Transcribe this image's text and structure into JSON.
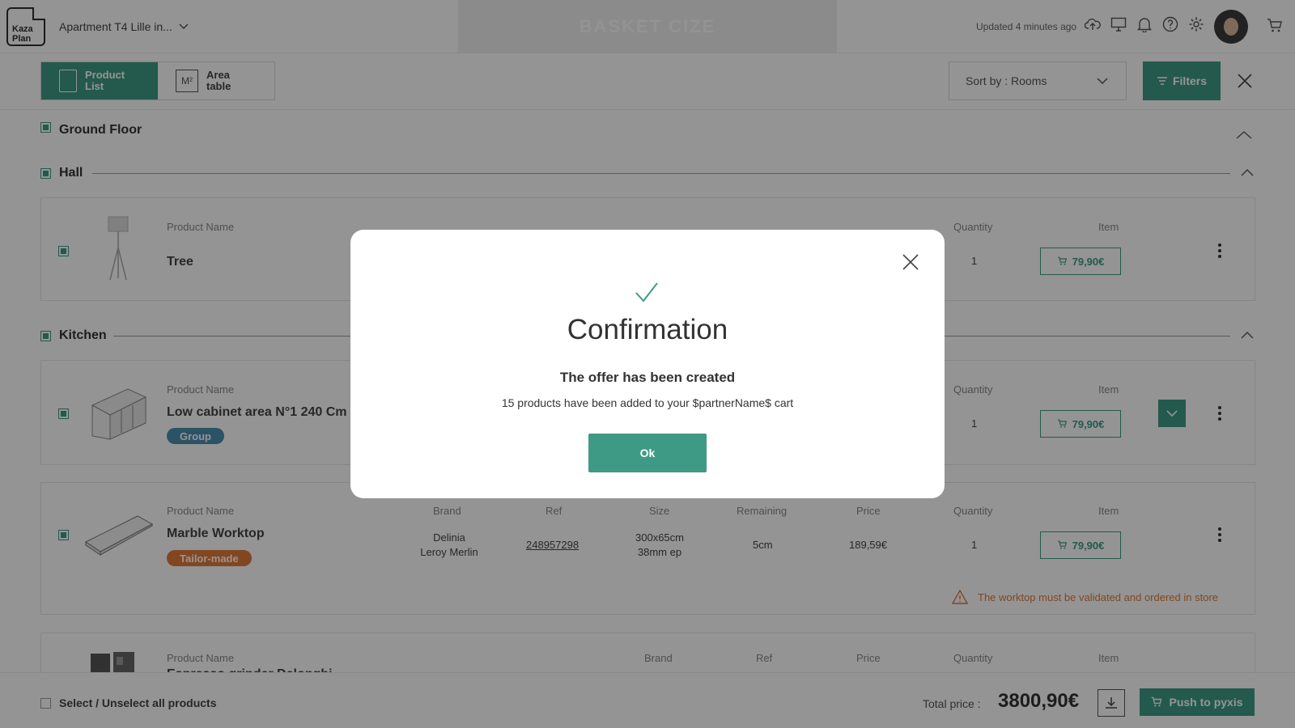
{
  "header": {
    "logo_line1": "Kaza",
    "logo_line2": "Plan",
    "project_name": "Apartment T4 Lille in...",
    "center_tab": "BASKET CIZE",
    "updated": "Updated 4 minutes ago",
    "icons": [
      "cloud-upload-icon",
      "monitor-icon",
      "bell-icon",
      "help-icon",
      "gear-icon",
      "cart-icon"
    ]
  },
  "toolbar": {
    "views": [
      {
        "label_line1": "Product",
        "label_line2": "List",
        "icon": "list-doc-icon",
        "active": true
      },
      {
        "label_line1": "Area",
        "label_line2": "table",
        "icon": "m2-icon",
        "icon_text": "M²",
        "active": false
      }
    ],
    "sort_label": "Sort by : Rooms",
    "filters_label": "Filters"
  },
  "floor": {
    "name": "Ground Floor"
  },
  "rooms": [
    {
      "name": "Hall"
    },
    {
      "name": "Kitchen"
    }
  ],
  "columns": {
    "product_name": "Product Name",
    "brand": "Brand",
    "ref": "Ref",
    "size": "Size",
    "remaining": "Remaining",
    "price": "Price",
    "quantity": "Quantity",
    "item": "Item"
  },
  "products": [
    {
      "name": "Tree",
      "quantity": "1",
      "item_price": "79,90€"
    },
    {
      "name": "Low cabinet area N°1 240 Cm",
      "tag": "Group",
      "quantity": "1",
      "item_price": "79,90€"
    },
    {
      "name": "Marble Worktop",
      "tag": "Tailor-made",
      "brand_line1": "Delinia",
      "brand_line2": "Leroy Merlin",
      "ref": "248957298",
      "size_line1": "300x65cm",
      "size_line2": "38mm ep",
      "remaining": "5cm",
      "price": "189,59€",
      "quantity": "1",
      "item_price": "79,90€",
      "warning": "The worktop must be validated and ordered in store"
    },
    {
      "name": "Espresso grinder Delonghi"
    }
  ],
  "colors": {
    "accent": "#3f9a85",
    "tag_group": "#4a8fb0",
    "tag_tailor": "#e07a3a",
    "warning": "#e07a3a"
  },
  "footer": {
    "select_all": "Select / Unselect all products",
    "total_label": "Total price :",
    "total_value": "3800,90€",
    "push_label": "Push to pyxis"
  },
  "modal": {
    "title": "Confirmation",
    "subtitle": "The offer has been created",
    "message": "15 products have been added to your $partnerName$ cart",
    "ok_label": "Ok"
  }
}
